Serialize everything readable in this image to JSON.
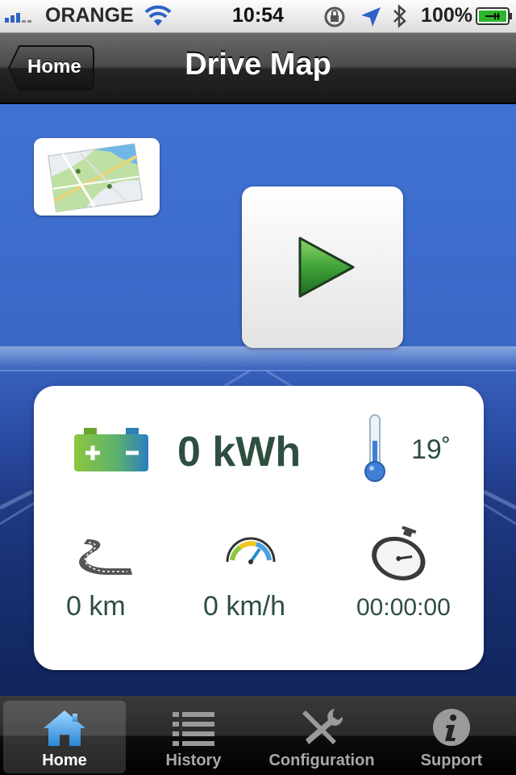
{
  "status_bar": {
    "carrier": "ORANGE",
    "time": "10:54",
    "battery": "100%"
  },
  "nav": {
    "back_label": "Home",
    "title": "Drive Map"
  },
  "main": {
    "map_icon": "map-icon",
    "play_icon": "play-icon",
    "energy": "0 kWh",
    "temperature": "19˚",
    "distance": "0 km",
    "speed": "0 km/h",
    "duration": "00:00:00"
  },
  "tabs": [
    {
      "label": "Home",
      "icon": "house-icon",
      "selected": true
    },
    {
      "label": "History",
      "icon": "list-icon",
      "selected": false
    },
    {
      "label": "Configuration",
      "icon": "tools-icon",
      "selected": false
    },
    {
      "label": "Support",
      "icon": "info-icon",
      "selected": false
    }
  ],
  "colors": {
    "accent_blue": "#3f72d3",
    "value_text": "#2e4f3f",
    "play_green": "#3fa33a"
  }
}
